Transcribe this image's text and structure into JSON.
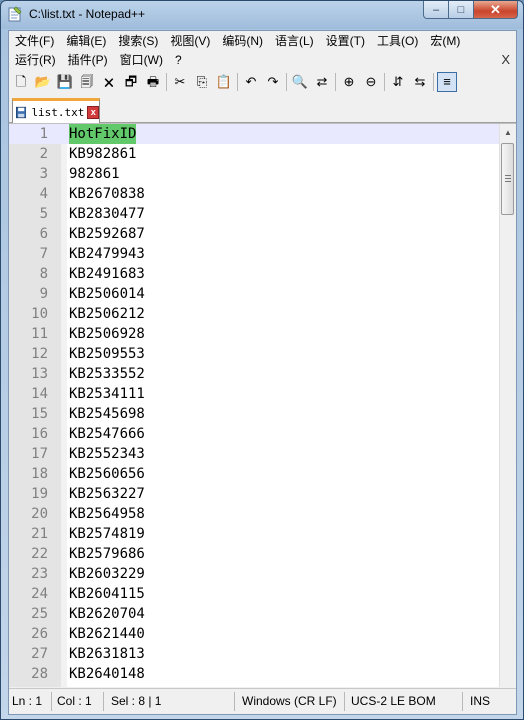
{
  "window": {
    "title": "C:\\list.txt - Notepad++"
  },
  "window_buttons": {
    "minimize": "–",
    "maximize": "□",
    "close": "✕"
  },
  "menu": {
    "row1": [
      "文件(F)",
      "编辑(E)",
      "搜索(S)",
      "视图(V)",
      "编码(N)",
      "语言(L)",
      "设置(T)",
      "工具(O)",
      "宏(M)"
    ],
    "row2": [
      "运行(R)",
      "插件(P)",
      "窗口(W)",
      "?"
    ],
    "close_label": "X"
  },
  "toolbar": {
    "buttons": [
      {
        "name": "new-file-icon",
        "glyph": "🗋"
      },
      {
        "name": "open-file-icon",
        "glyph": "📂"
      },
      {
        "name": "save-icon",
        "glyph": "💾"
      },
      {
        "name": "save-all-icon",
        "glyph": "🗐"
      },
      {
        "name": "close-file-icon",
        "glyph": "🗙"
      },
      {
        "name": "close-all-icon",
        "glyph": "🗗"
      },
      {
        "name": "print-icon",
        "glyph": "🖶"
      },
      {
        "sep": true
      },
      {
        "name": "cut-icon",
        "glyph": "✂"
      },
      {
        "name": "copy-icon",
        "glyph": "⎘"
      },
      {
        "name": "paste-icon",
        "glyph": "📋"
      },
      {
        "sep": true
      },
      {
        "name": "undo-icon",
        "glyph": "↶"
      },
      {
        "name": "redo-icon",
        "glyph": "↷"
      },
      {
        "sep": true
      },
      {
        "name": "find-icon",
        "glyph": "🔍"
      },
      {
        "name": "replace-icon",
        "glyph": "⇄"
      },
      {
        "sep": true
      },
      {
        "name": "zoom-in-icon",
        "glyph": "⊕"
      },
      {
        "name": "zoom-out-icon",
        "glyph": "⊖"
      },
      {
        "sep": true
      },
      {
        "name": "sync-vertical-icon",
        "glyph": "⇵"
      },
      {
        "name": "sync-horizontal-icon",
        "glyph": "⇆"
      },
      {
        "sep": true
      },
      {
        "name": "word-wrap-icon",
        "glyph": "≡",
        "active": true
      }
    ]
  },
  "tab": {
    "label": "list.txt",
    "close": "x"
  },
  "editor": {
    "selection_color": "#62c96b",
    "current_line_color": "#e8e8ff",
    "lines": [
      "HotFixID",
      "KB982861",
      "982861",
      "KB2670838",
      "KB2830477",
      "KB2592687",
      "KB2479943",
      "KB2491683",
      "KB2506014",
      "KB2506212",
      "KB2506928",
      "KB2509553",
      "KB2533552",
      "KB2534111",
      "KB2545698",
      "KB2547666",
      "KB2552343",
      "KB2560656",
      "KB2563227",
      "KB2564958",
      "KB2574819",
      "KB2579686",
      "KB2603229",
      "KB2604115",
      "KB2620704",
      "KB2621440",
      "KB2631813",
      "KB2640148"
    ]
  },
  "status": {
    "ln": "Ln : 1",
    "col": "Col : 1",
    "sel": "Sel : 8 | 1",
    "eol": "Windows (CR LF)",
    "encoding": "UCS-2 LE BOM",
    "mode": "INS"
  }
}
